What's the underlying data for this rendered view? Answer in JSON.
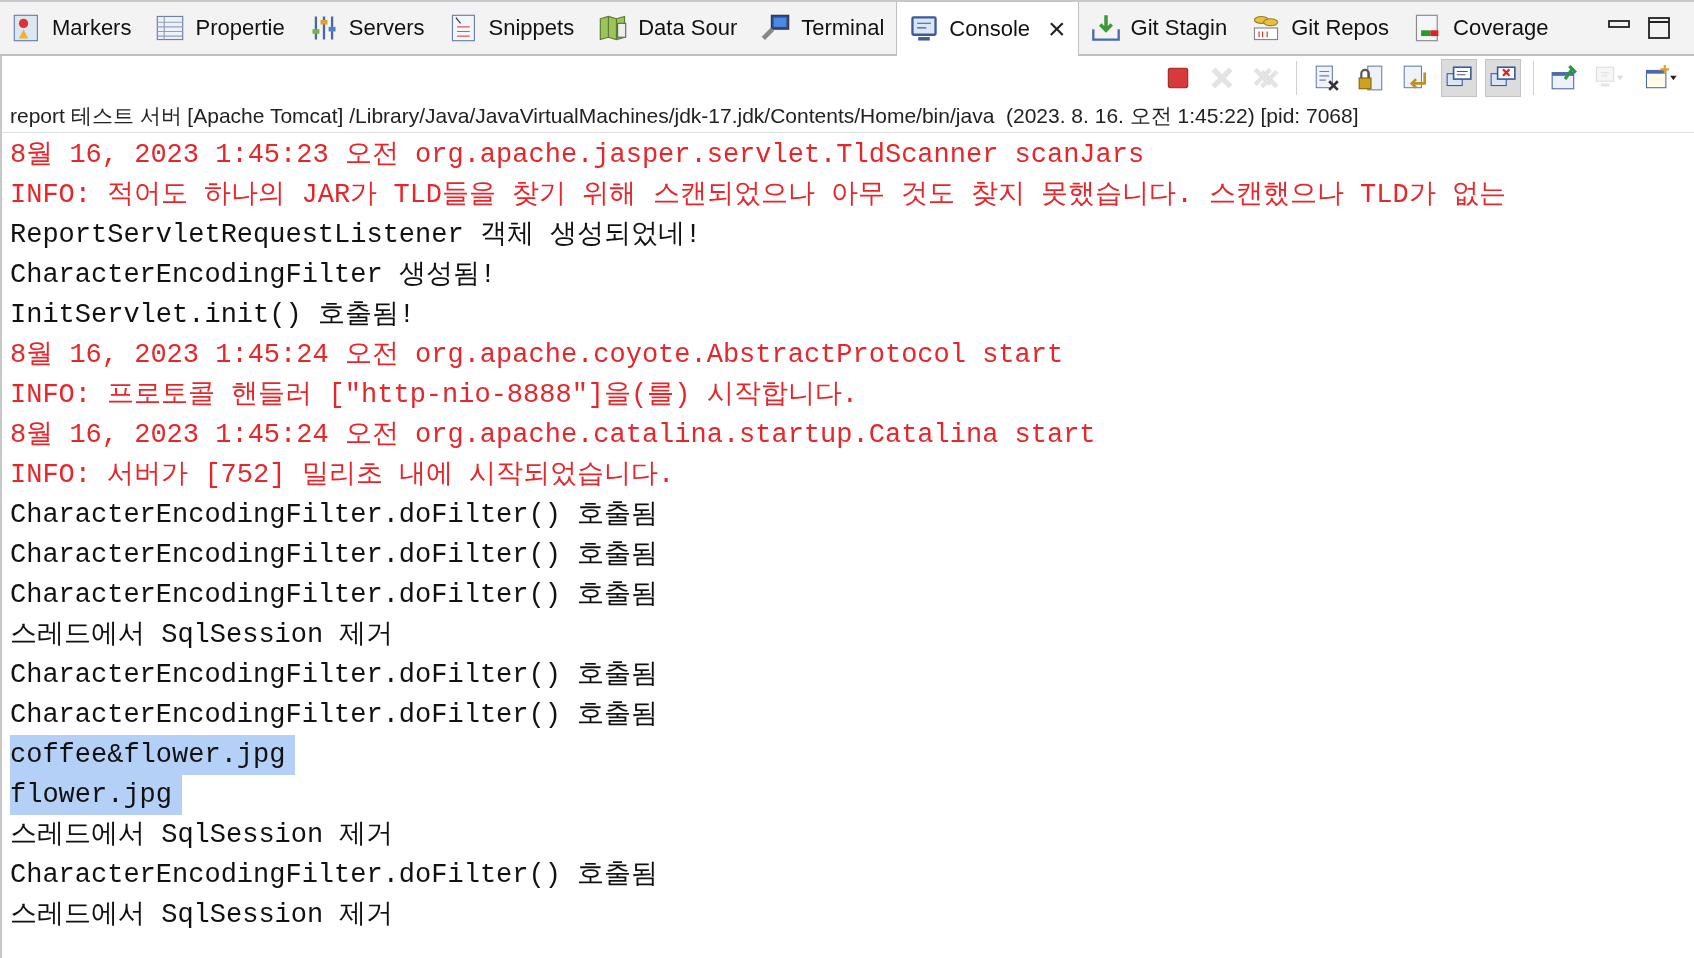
{
  "tabs": [
    {
      "kind": "markers",
      "label": "Markers",
      "selected": false
    },
    {
      "kind": "properties",
      "label": "Propertie",
      "selected": false
    },
    {
      "kind": "servers",
      "label": "Servers",
      "selected": false
    },
    {
      "kind": "snippets",
      "label": "Snippets",
      "selected": false
    },
    {
      "kind": "datasource",
      "label": "Data Sour",
      "selected": false
    },
    {
      "kind": "terminal",
      "label": "Terminal",
      "selected": false
    },
    {
      "kind": "console",
      "label": "Console",
      "selected": true,
      "close": "×"
    },
    {
      "kind": "gitstaging",
      "label": "Git Stagin",
      "selected": false
    },
    {
      "kind": "gitrepos",
      "label": "Git Repos",
      "selected": false
    },
    {
      "kind": "coverage",
      "label": "Coverage",
      "selected": false
    }
  ],
  "toolbar": [
    {
      "kind": "terminate",
      "disabled": false,
      "pressed": false
    },
    {
      "kind": "remove",
      "disabled": true,
      "pressed": false
    },
    {
      "kind": "removeall",
      "disabled": true,
      "pressed": false
    },
    {
      "kind": "clear",
      "disabled": false,
      "pressed": false
    },
    {
      "kind": "scrolllock",
      "disabled": false,
      "pressed": false
    },
    {
      "kind": "wordwrap",
      "disabled": false,
      "pressed": false
    },
    {
      "kind": "showout",
      "disabled": false,
      "pressed": true
    },
    {
      "kind": "showerr",
      "disabled": false,
      "pressed": true
    },
    {
      "kind": "pin",
      "disabled": false,
      "pressed": false
    },
    {
      "kind": "display",
      "disabled": true,
      "pressed": false
    },
    {
      "kind": "newconsole",
      "disabled": false,
      "pressed": false
    }
  ],
  "console": {
    "title": "report 테스트 서버 [Apache Tomcat] /Library/Java/JavaVirtualMachines/jdk-17.jdk/Contents/Home/bin/java  (2023. 8. 16. 오전 1:45:22) [pid: 7068]",
    "lines": [
      {
        "kind": "err",
        "text": "8월 16, 2023 1:45:23 오전 org.apache.jasper.servlet.TldScanner scanJars",
        "selected": false
      },
      {
        "kind": "err",
        "text": "INFO: 적어도 하나의 JAR가 TLD들을 찾기 위해 스캔되었으나 아무 것도 찾지 못했습니다. 스캔했으나 TLD가 없는",
        "selected": false
      },
      {
        "kind": "out",
        "text": "ReportServletRequestListener 객체 생성되었네!",
        "selected": false
      },
      {
        "kind": "out",
        "text": "CharacterEncodingFilter 생성됨!",
        "selected": false
      },
      {
        "kind": "out",
        "text": "InitServlet.init() 호출됨!",
        "selected": false
      },
      {
        "kind": "err",
        "text": "8월 16, 2023 1:45:24 오전 org.apache.coyote.AbstractProtocol start",
        "selected": false
      },
      {
        "kind": "err",
        "text": "INFO: 프로토콜 핸들러 [\"http-nio-8888\"]을(를) 시작합니다.",
        "selected": false
      },
      {
        "kind": "err",
        "text": "8월 16, 2023 1:45:24 오전 org.apache.catalina.startup.Catalina start",
        "selected": false
      },
      {
        "kind": "err",
        "text": "INFO: 서버가 [752] 밀리초 내에 시작되었습니다.",
        "selected": false
      },
      {
        "kind": "out",
        "text": "CharacterEncodingFilter.doFilter() 호출됨",
        "selected": false
      },
      {
        "kind": "out",
        "text": "CharacterEncodingFilter.doFilter() 호출됨",
        "selected": false
      },
      {
        "kind": "out",
        "text": "CharacterEncodingFilter.doFilter() 호출됨",
        "selected": false
      },
      {
        "kind": "out",
        "text": "스레드에서 SqlSession 제거",
        "selected": false
      },
      {
        "kind": "out",
        "text": "CharacterEncodingFilter.doFilter() 호출됨",
        "selected": false
      },
      {
        "kind": "out",
        "text": "CharacterEncodingFilter.doFilter() 호출됨",
        "selected": false
      },
      {
        "kind": "out",
        "text": "coffee&flower.jpg",
        "selected": true
      },
      {
        "kind": "out",
        "text": "flower.jpg",
        "selected": true
      },
      {
        "kind": "out",
        "text": "스레드에서 SqlSession 제거",
        "selected": false
      },
      {
        "kind": "out",
        "text": "CharacterEncodingFilter.doFilter() 호출됨",
        "selected": false
      },
      {
        "kind": "out",
        "text": "스레드에서 SqlSession 제거",
        "selected": false
      }
    ]
  }
}
